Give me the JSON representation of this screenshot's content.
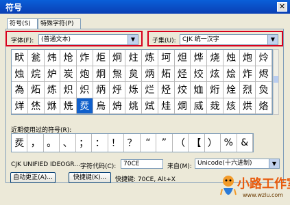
{
  "window": {
    "title": "符号",
    "close_icon": "close-icon"
  },
  "tabs": [
    {
      "label": "符号(S)"
    },
    {
      "label": "特殊字符(P)"
    }
  ],
  "font": {
    "label": "字体(F):",
    "value": "(普通文本)"
  },
  "subset": {
    "label": "子集(U):",
    "value": "CJK 统一汉字"
  },
  "symbols": [
    "畎",
    "瓮",
    "炜",
    "炝",
    "炸",
    "炬",
    "炯",
    "炷",
    "炼",
    "坷",
    "炟",
    "烨",
    "烧",
    "烛",
    "炮",
    "炩",
    "烛",
    "烷",
    "炉",
    "炭",
    "炮",
    "炯",
    "炰",
    "炱",
    "炳",
    "炻",
    "烃",
    "烄",
    "炫",
    "烩",
    "炸",
    "烬",
    "為",
    "炻",
    "炼",
    "炽",
    "炽",
    "炳",
    "烀",
    "烁",
    "烂",
    "烃",
    "烄",
    "烅",
    "烆",
    "烇",
    "烈",
    "烉",
    "烊",
    "烋",
    "烌",
    "烍",
    "烎",
    "烏",
    "烐",
    "烑",
    "烒",
    "烓",
    "烔",
    "烕",
    "烖",
    "烗",
    "烘",
    "烙"
  ],
  "recent": {
    "label": "近期使用过的符号(R):",
    "items": [
      "烎",
      "，",
      "。",
      "、",
      "；",
      "：",
      "！",
      "？",
      "“",
      "”",
      "（",
      "【",
      "）",
      "%",
      "&"
    ]
  },
  "char_name": "CJK UNIFIED IDEOGR...",
  "char_code": {
    "label": "字符代码(C):",
    "value": "70CE"
  },
  "from": {
    "label": "来自(M):",
    "value": "Unicode(十六进制)"
  },
  "buttons": {
    "autocorrect": "自动更正(A)...",
    "shortcut": "快捷键(K)..."
  },
  "shortcut_text": "快捷键: 70CE, Alt+X",
  "logo": {
    "text": "小路工作室",
    "url": "www.wzlu.com"
  }
}
